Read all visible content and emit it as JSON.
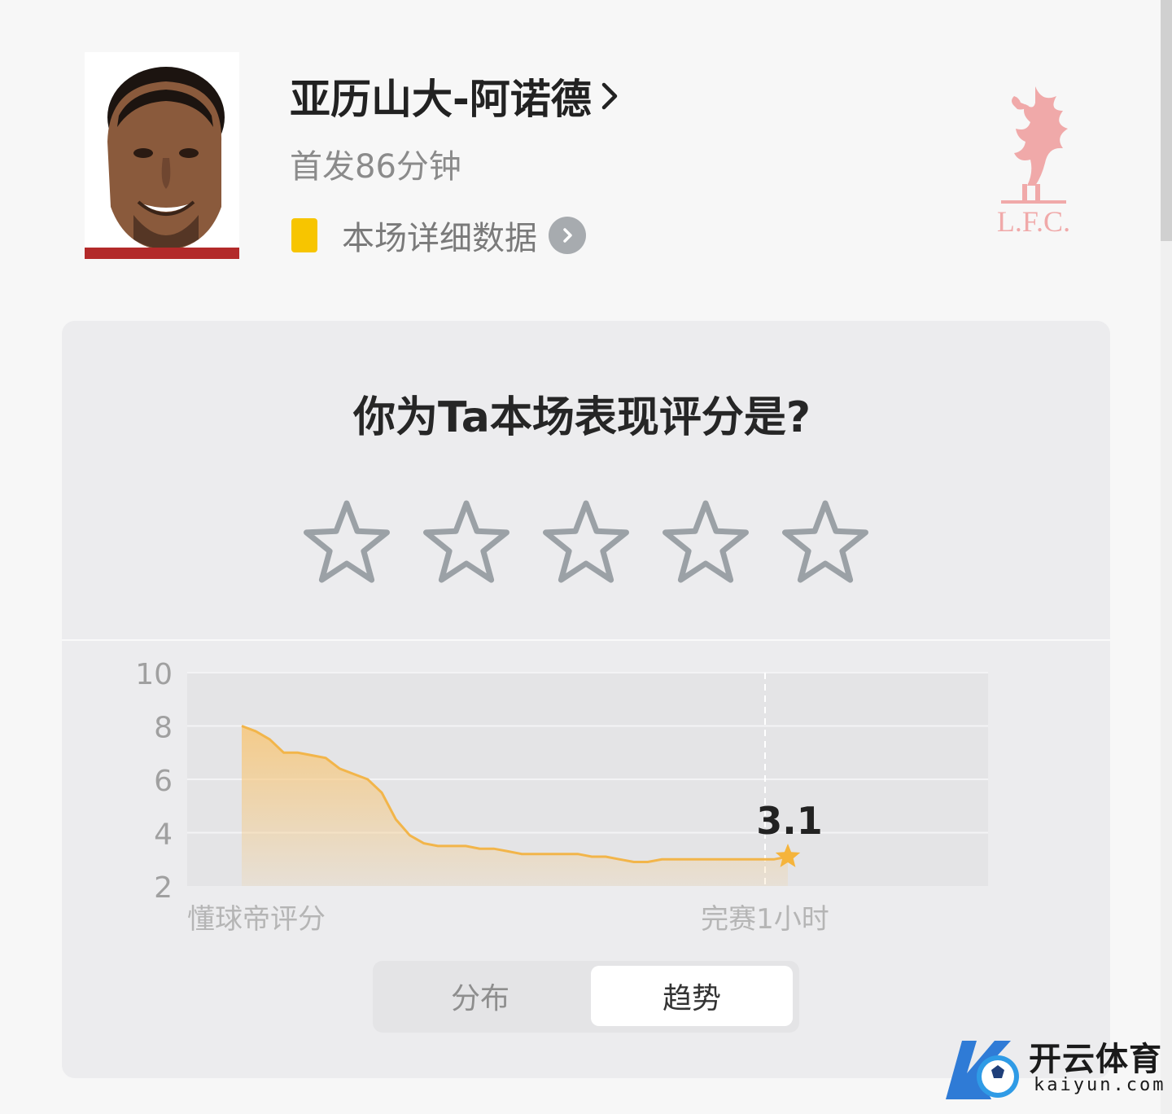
{
  "player": {
    "name": "亚历山大-阿诺德",
    "minutes_text": "首发86分钟",
    "details_link": "本场详细数据",
    "club_logo_text": "L.F.C."
  },
  "rating": {
    "question": "你为Ta本场表现评分是?",
    "stars_count": 5,
    "selected_stars": 0
  },
  "chart_data": {
    "type": "area",
    "ylim": [
      2,
      10
    ],
    "y_ticks": [
      "10",
      "8",
      "6",
      "4",
      "2"
    ],
    "xlabel_left": "懂球帝评分",
    "xlabel_right": "完赛1小时",
    "current_value": "3.1",
    "series": [
      {
        "values": [
          8.0,
          7.8,
          7.5,
          7.0,
          7.0,
          6.9,
          6.8,
          6.4,
          6.2,
          6.0,
          5.5,
          4.5,
          3.9,
          3.6,
          3.5,
          3.5,
          3.5,
          3.4,
          3.4,
          3.3,
          3.2,
          3.2,
          3.2,
          3.2,
          3.2,
          3.1,
          3.1,
          3.0,
          2.9,
          2.9,
          3.0,
          3.0,
          3.0,
          3.0,
          3.0,
          3.0,
          3.0,
          3.0,
          3.0,
          3.1
        ]
      }
    ],
    "colors": {
      "line": "#f2b54a",
      "fill": "#f7c77a",
      "star": "#f5b43c"
    }
  },
  "tabs": {
    "distribution": "分布",
    "trend": "趋势",
    "active": "trend"
  },
  "watermark": {
    "name": "开云体育",
    "url": "kaiyun.com"
  }
}
